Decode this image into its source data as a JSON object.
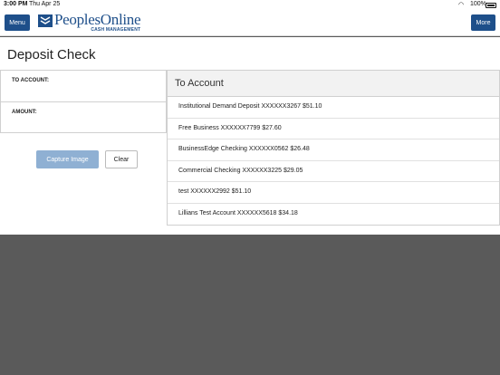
{
  "status": {
    "time": "3:00 PM",
    "date": "Thu Apr 25",
    "battery": "100%"
  },
  "nav": {
    "menu_label": "Menu",
    "more_label": "More",
    "logo_name": "PeoplesOnline",
    "logo_sub": "CASH MANAGEMENT",
    "brand_color": "#1e4f8a"
  },
  "page": {
    "title": "Deposit Check"
  },
  "form": {
    "to_account_label": "TO ACCOUNT:",
    "amount_label": "AMOUNT:",
    "capture_label": "Capture Image",
    "clear_label": "Clear"
  },
  "accounts": {
    "header": "To Account",
    "items": [
      {
        "label": "Institutional Demand Deposit XXXXXX3267 $51.10"
      },
      {
        "label": "Free Business XXXXXX7799 $27.60"
      },
      {
        "label": "BusinessEdge Checking XXXXXX0562 $26.48"
      },
      {
        "label": "Commercial Checking XXXXXX3225 $29.05"
      },
      {
        "label": "test XXXXXX2992 $51.10"
      },
      {
        "label": "Lillians Test Account XXXXXX5618 $34.18"
      }
    ]
  }
}
